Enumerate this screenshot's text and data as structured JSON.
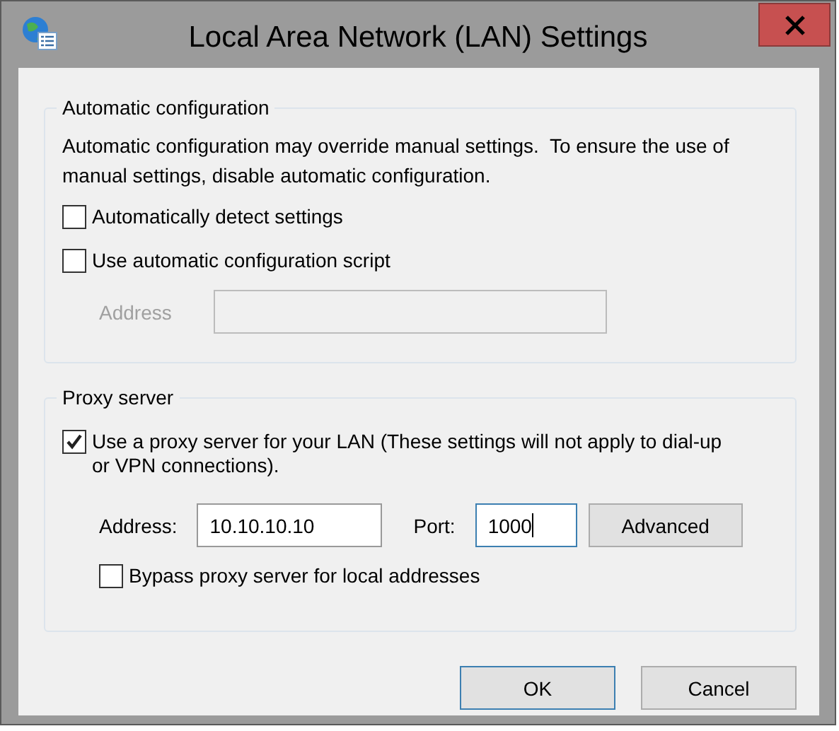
{
  "window": {
    "title": "Local Area Network (LAN) Settings"
  },
  "automatic_configuration": {
    "title": "Automatic configuration",
    "description": "Automatic configuration may override manual settings.  To ensure the use of manual settings, disable automatic configuration.",
    "options": [
      {
        "label": "Automatically detect settings",
        "checked": false
      },
      {
        "label": "Use automatic configuration script",
        "checked": false
      }
    ],
    "address": {
      "label": "Address",
      "disabled": true
    }
  },
  "proxy_server": {
    "title": "Proxy server",
    "use_proxy": {
      "label": "Use a proxy server for your LAN (These settings will not apply to dial-up or VPN connections).",
      "checked": true
    },
    "address": {
      "label": "Address:",
      "value": "10.10.10.10",
      "focused": false
    },
    "port": {
      "label": "Port:",
      "value": "1000",
      "focused": true
    },
    "advanced_button": "Advanced",
    "bypass": {
      "label": "Bypass proxy server for local addresses",
      "checked": false
    }
  },
  "buttons": [
    {
      "label": "OK",
      "default": true
    },
    {
      "label": "Cancel",
      "default": false
    }
  ]
}
